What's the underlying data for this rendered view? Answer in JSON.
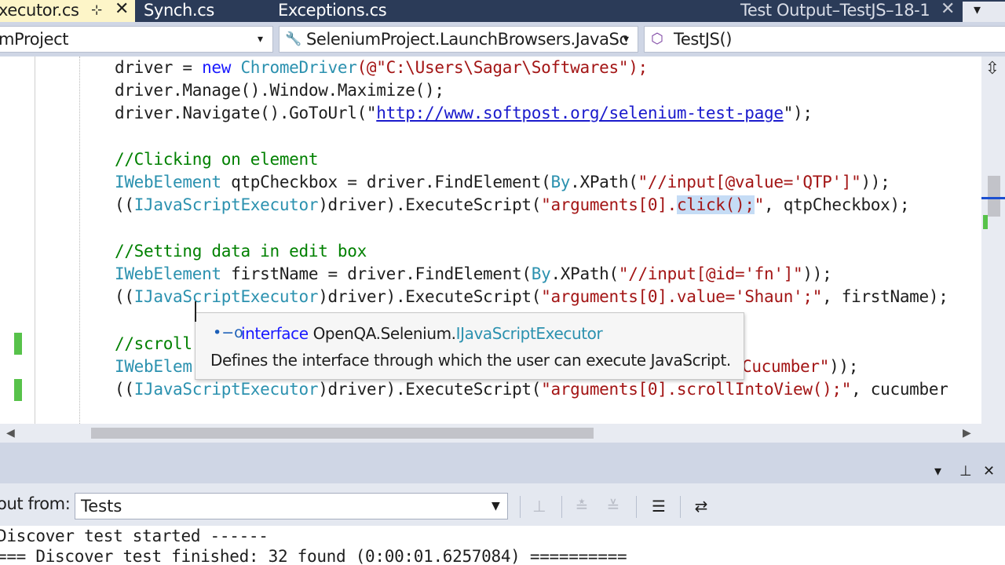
{
  "tabs": {
    "active": "xecutor.cs",
    "active_pin": "⊹",
    "active_close": "✕",
    "synch": "Synch.cs",
    "exceptions": "Exceptions.cs",
    "test_output": "Test Output–TestJS–18-1",
    "test_output_close": "✕",
    "dropdown": "▾"
  },
  "navbar": {
    "project": "mProject",
    "class": "SeleniumProject.LaunchBrowsers.JavaSc",
    "member": "TestJS()",
    "arrow": "▾"
  },
  "code": {
    "l1": [
      "driver = ",
      "new ",
      "ChromeDriver",
      "(@\"C:\\Users\\Sagar\\Softwares\");"
    ],
    "l2": "driver.Manage().Window.Maximize();",
    "l3": [
      "driver.Navigate().GoToUrl(\"",
      "http://www.softpost.org/selenium-test-page",
      "\");"
    ],
    "l5": "//Clicking on element",
    "l6": [
      "IWebElement",
      " qtpCheckbox = driver.FindElement(",
      "By",
      ".XPath(",
      "\"//input[@value='QTP']\"",
      "));"
    ],
    "l7": [
      "((",
      "IJavaScriptExecutor",
      ")driver).ExecuteScript(",
      "\"arguments[0].",
      "click();",
      "\"",
      ", qtpCheckbox);"
    ],
    "l9": "//Setting data in edit box",
    "l10": [
      "IWebElement",
      " firstName = driver.FindElement(",
      "By",
      ".XPath(",
      "\"//input[@id='fn']\"",
      "));"
    ],
    "l11": [
      "((",
      "IJavaScriptExecutor",
      ")driver).ExecuteScript(",
      "\"arguments[0].value='Shaun';\"",
      ", firstName);"
    ],
    "l13": "//scroll",
    "l14": [
      "IWebElem",
      "Cucumber\"",
      "));"
    ],
    "l15": [
      "((",
      "IJavaScriptExecutor",
      ")driver).ExecuteScript(",
      "\"arguments[0].scrollIntoView();\"",
      ", cucumber"
    ]
  },
  "tooltip": {
    "kind": "interface",
    "namespace": "OpenQA.Selenium.",
    "type": "IJavaScriptExecutor",
    "description": "Defines the interface through which the user can execute JavaScript."
  },
  "output": {
    "show_from_label": "out from:",
    "source": "Tests",
    "lines": [
      "Discover test started ------",
      "=== Discover test finished: 32 found (0:00:01.6257084) =========="
    ],
    "pane_controls": [
      "▾",
      "⊥",
      "✕"
    ]
  },
  "icons": {
    "splitter": "⇳",
    "class_icon": "wrench-class-icon",
    "method_icon": "method-cube-icon",
    "interface_icon": "interface-icon"
  },
  "colors": {
    "keyword": "#1a1aff",
    "type": "#2b91af",
    "string": "#a31515",
    "comment": "#008000",
    "tab_bar": "#2b3b58",
    "active_tab": "#fdf5c8",
    "change_marker": "#57c24a"
  }
}
